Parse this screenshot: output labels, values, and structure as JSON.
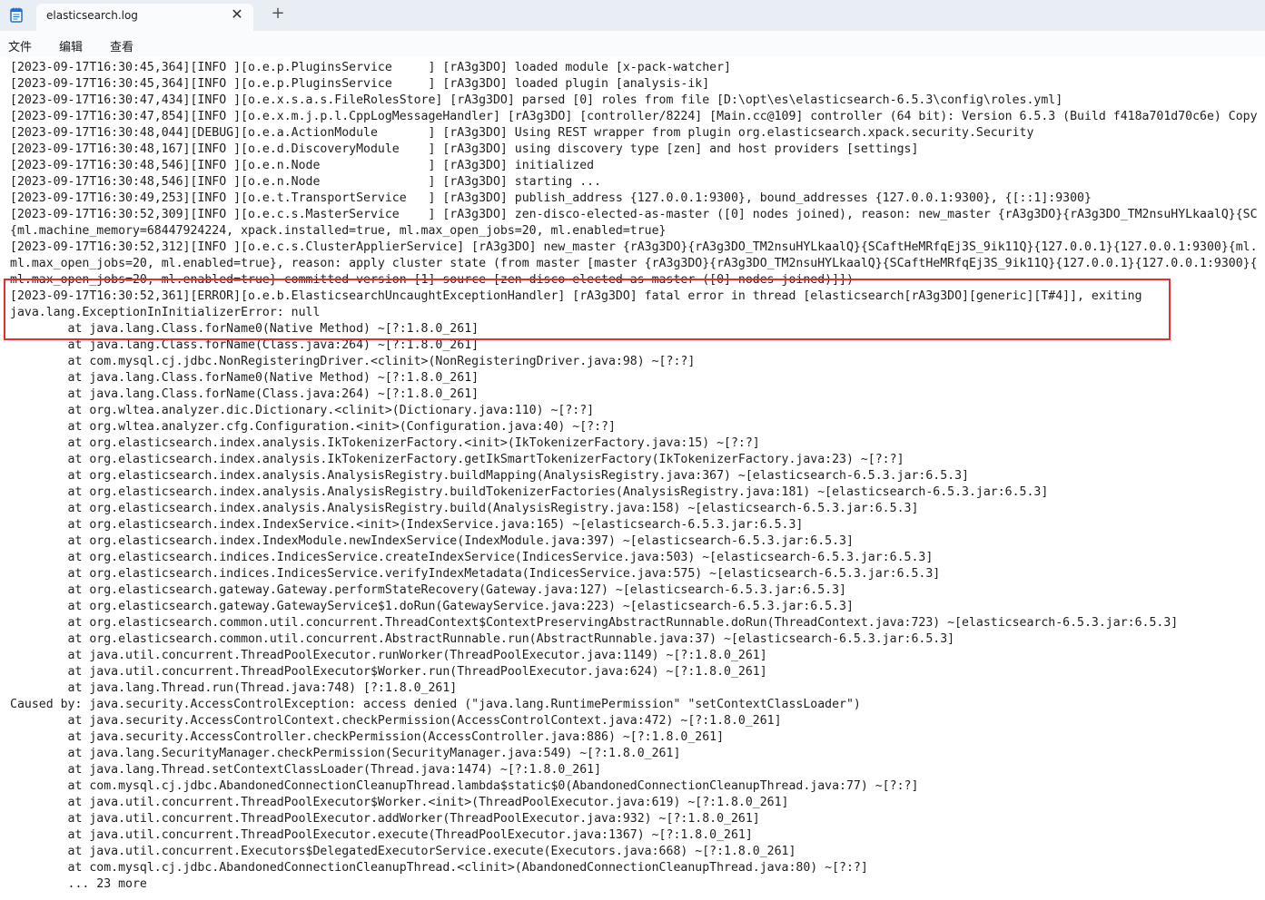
{
  "window": {
    "app_icon": "notepad-icon",
    "tab_title": "elasticsearch.log",
    "close_icon": "close-icon",
    "new_tab_icon": "plus-icon",
    "close_glyph": "✕",
    "new_tab_glyph": "+"
  },
  "menu": {
    "file": "文件",
    "edit": "编辑",
    "view": "查看"
  },
  "annotation": {
    "color": "#e03030"
  },
  "log_lines": [
    "[2023-09-17T16:30:45,364][INFO ][o.e.p.PluginsService     ] [rA3g3DO] loaded module [x-pack-watcher]",
    "[2023-09-17T16:30:45,364][INFO ][o.e.p.PluginsService     ] [rA3g3DO] loaded plugin [analysis-ik]",
    "[2023-09-17T16:30:47,434][INFO ][o.e.x.s.a.s.FileRolesStore] [rA3g3DO] parsed [0] roles from file [D:\\opt\\es\\elasticsearch-6.5.3\\config\\roles.yml]",
    "[2023-09-17T16:30:47,854][INFO ][o.e.x.m.j.p.l.CppLogMessageHandler] [rA3g3DO] [controller/8224] [Main.cc@109] controller (64 bit): Version 6.5.3 (Build f418a701d70c6e) Copy",
    "[2023-09-17T16:30:48,044][DEBUG][o.e.a.ActionModule       ] [rA3g3DO] Using REST wrapper from plugin org.elasticsearch.xpack.security.Security",
    "[2023-09-17T16:30:48,167][INFO ][o.e.d.DiscoveryModule    ] [rA3g3DO] using discovery type [zen] and host providers [settings]",
    "[2023-09-17T16:30:48,546][INFO ][o.e.n.Node               ] [rA3g3DO] initialized",
    "[2023-09-17T16:30:48,546][INFO ][o.e.n.Node               ] [rA3g3DO] starting ...",
    "[2023-09-17T16:30:49,253][INFO ][o.e.t.TransportService   ] [rA3g3DO] publish_address {127.0.0.1:9300}, bound_addresses {127.0.0.1:9300}, {[::1]:9300}",
    "[2023-09-17T16:30:52,309][INFO ][o.e.c.s.MasterService    ] [rA3g3DO] zen-disco-elected-as-master ([0] nodes joined), reason: new_master {rA3g3DO}{rA3g3DO_TM2nsuHYLkaalQ}{SC",
    "{ml.machine_memory=68447924224, xpack.installed=true, ml.max_open_jobs=20, ml.enabled=true}",
    "[2023-09-17T16:30:52,312][INFO ][o.e.c.s.ClusterApplierService] [rA3g3DO] new_master {rA3g3DO}{rA3g3DO_TM2nsuHYLkaalQ}{SCaftHeMRfqEj3S_9ik11Q}{127.0.0.1}{127.0.0.1:9300}{ml.",
    "ml.max_open_jobs=20, ml.enabled=true}, reason: apply cluster state (from master [master {rA3g3DO}{rA3g3DO_TM2nsuHYLkaalQ}{SCaftHeMRfqEj3S_9ik11Q}{127.0.0.1}{127.0.0.1:9300}{",
    "ml.max_open_jobs=20, ml.enabled=true} committed version [1] source [zen-disco-elected-as-master ([0] nodes joined)]])",
    "[2023-09-17T16:30:52,361][ERROR][o.e.b.ElasticsearchUncaughtExceptionHandler] [rA3g3DO] fatal error in thread [elasticsearch[rA3g3DO][generic][T#4]], exiting",
    "java.lang.ExceptionInInitializerError: null",
    "        at java.lang.Class.forName0(Native Method) ~[?:1.8.0_261]",
    "        at java.lang.Class.forName(Class.java:264) ~[?:1.8.0_261]",
    "        at com.mysql.cj.jdbc.NonRegisteringDriver.<clinit>(NonRegisteringDriver.java:98) ~[?:?]",
    "        at java.lang.Class.forName0(Native Method) ~[?:1.8.0_261]",
    "        at java.lang.Class.forName(Class.java:264) ~[?:1.8.0_261]",
    "        at org.wltea.analyzer.dic.Dictionary.<clinit>(Dictionary.java:110) ~[?:?]",
    "        at org.wltea.analyzer.cfg.Configuration.<init>(Configuration.java:40) ~[?:?]",
    "        at org.elasticsearch.index.analysis.IkTokenizerFactory.<init>(IkTokenizerFactory.java:15) ~[?:?]",
    "        at org.elasticsearch.index.analysis.IkTokenizerFactory.getIkSmartTokenizerFactory(IkTokenizerFactory.java:23) ~[?:?]",
    "        at org.elasticsearch.index.analysis.AnalysisRegistry.buildMapping(AnalysisRegistry.java:367) ~[elasticsearch-6.5.3.jar:6.5.3]",
    "        at org.elasticsearch.index.analysis.AnalysisRegistry.buildTokenizerFactories(AnalysisRegistry.java:181) ~[elasticsearch-6.5.3.jar:6.5.3]",
    "        at org.elasticsearch.index.analysis.AnalysisRegistry.build(AnalysisRegistry.java:158) ~[elasticsearch-6.5.3.jar:6.5.3]",
    "        at org.elasticsearch.index.IndexService.<init>(IndexService.java:165) ~[elasticsearch-6.5.3.jar:6.5.3]",
    "        at org.elasticsearch.index.IndexModule.newIndexService(IndexModule.java:397) ~[elasticsearch-6.5.3.jar:6.5.3]",
    "        at org.elasticsearch.indices.IndicesService.createIndexService(IndicesService.java:503) ~[elasticsearch-6.5.3.jar:6.5.3]",
    "        at org.elasticsearch.indices.IndicesService.verifyIndexMetadata(IndicesService.java:575) ~[elasticsearch-6.5.3.jar:6.5.3]",
    "        at org.elasticsearch.gateway.Gateway.performStateRecovery(Gateway.java:127) ~[elasticsearch-6.5.3.jar:6.5.3]",
    "        at org.elasticsearch.gateway.GatewayService$1.doRun(GatewayService.java:223) ~[elasticsearch-6.5.3.jar:6.5.3]",
    "        at org.elasticsearch.common.util.concurrent.ThreadContext$ContextPreservingAbstractRunnable.doRun(ThreadContext.java:723) ~[elasticsearch-6.5.3.jar:6.5.3]",
    "        at org.elasticsearch.common.util.concurrent.AbstractRunnable.run(AbstractRunnable.java:37) ~[elasticsearch-6.5.3.jar:6.5.3]",
    "        at java.util.concurrent.ThreadPoolExecutor.runWorker(ThreadPoolExecutor.java:1149) ~[?:1.8.0_261]",
    "        at java.util.concurrent.ThreadPoolExecutor$Worker.run(ThreadPoolExecutor.java:624) ~[?:1.8.0_261]",
    "        at java.lang.Thread.run(Thread.java:748) [?:1.8.0_261]",
    "Caused by: java.security.AccessControlException: access denied (\"java.lang.RuntimePermission\" \"setContextClassLoader\")",
    "        at java.security.AccessControlContext.checkPermission(AccessControlContext.java:472) ~[?:1.8.0_261]",
    "        at java.security.AccessController.checkPermission(AccessController.java:886) ~[?:1.8.0_261]",
    "        at java.lang.SecurityManager.checkPermission(SecurityManager.java:549) ~[?:1.8.0_261]",
    "        at java.lang.Thread.setContextClassLoader(Thread.java:1474) ~[?:1.8.0_261]",
    "        at com.mysql.cj.jdbc.AbandonedConnectionCleanupThread.lambda$static$0(AbandonedConnectionCleanupThread.java:77) ~[?:?]",
    "        at java.util.concurrent.ThreadPoolExecutor$Worker.<init>(ThreadPoolExecutor.java:619) ~[?:1.8.0_261]",
    "        at java.util.concurrent.ThreadPoolExecutor.addWorker(ThreadPoolExecutor.java:932) ~[?:1.8.0_261]",
    "        at java.util.concurrent.ThreadPoolExecutor.execute(ThreadPoolExecutor.java:1367) ~[?:1.8.0_261]",
    "        at java.util.concurrent.Executors$DelegatedExecutorService.execute(Executors.java:668) ~[?:1.8.0_261]",
    "        at com.mysql.cj.jdbc.AbandonedConnectionCleanupThread.<clinit>(AbandonedConnectionCleanupThread.java:80) ~[?:?]",
    "        ... 23 more"
  ]
}
